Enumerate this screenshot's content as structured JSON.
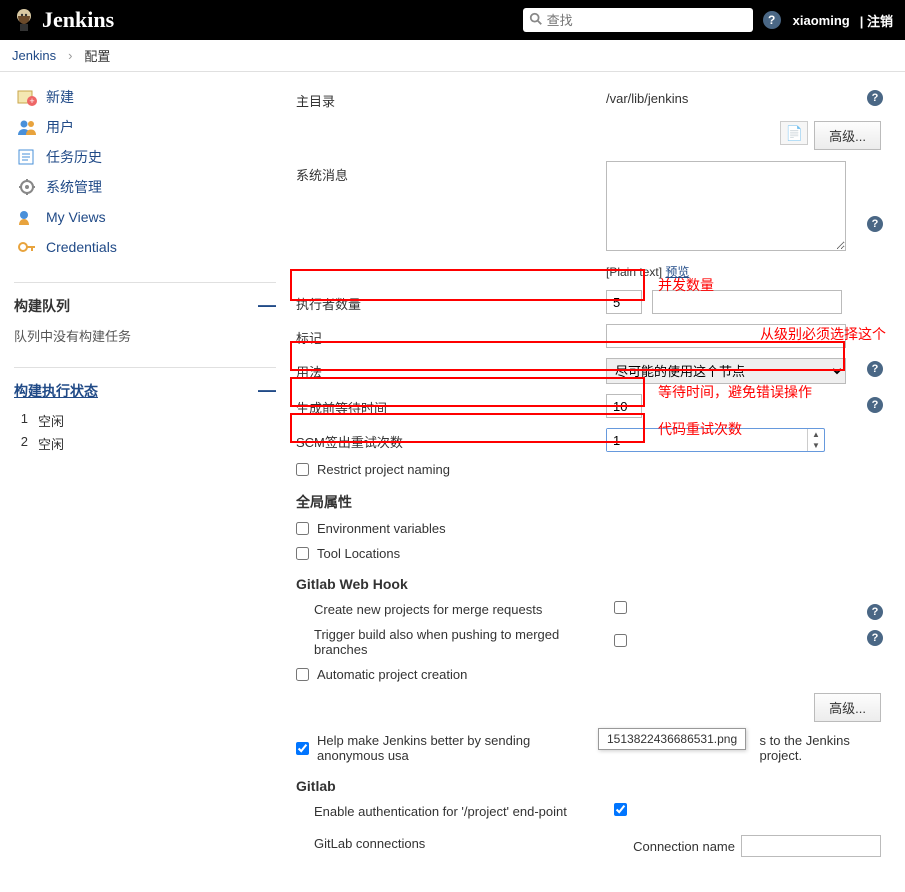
{
  "header": {
    "logo_text": "Jenkins",
    "search_placeholder": "查找",
    "user": "xiaoming",
    "logout": "| 注销"
  },
  "breadcrumb": {
    "root": "Jenkins",
    "current": "配置"
  },
  "sidebar": {
    "tasks": {
      "new": "新建",
      "people": "用户",
      "history": "任务历史",
      "manage": "系统管理",
      "myviews": "My Views",
      "credentials": "Credentials"
    },
    "queue": {
      "title": "构建队列",
      "empty": "队列中没有构建任务"
    },
    "executors": {
      "title": "构建执行状态",
      "rows": [
        {
          "n": "1",
          "label": "空闲"
        },
        {
          "n": "2",
          "label": "空闲"
        }
      ]
    }
  },
  "form": {
    "home_label": "主目录",
    "home_value": "/var/lib/jenkins",
    "sysmsg_label": "系统消息",
    "plain_text": "[Plain text]",
    "preview": "预览",
    "executors_label": "执行者数量",
    "executors_value": "5",
    "labels_label": "标记",
    "labels_value": "",
    "usage_label": "用法",
    "usage_value": "尽可能的使用这个节点",
    "quiet_label": "生成前等待时间",
    "quiet_value": "10",
    "scm_label": "SCM签出重试次数",
    "scm_value": "1",
    "restrict_label": "Restrict project naming",
    "global_props": "全局属性",
    "envvars_label": "Environment variables",
    "toolloc_label": "Tool Locations",
    "gitlab_hook": "Gitlab Web Hook",
    "git_create": "Create new projects for merge requests",
    "git_trigger": "Trigger build also when pushing to merged branches",
    "git_auto": "Automatic project creation",
    "help_usage_prefix": "Help make Jenkins better by sending anonymous usa",
    "help_usage_suffix": "s to the Jenkins project.",
    "gitlab_section": "Gitlab",
    "gitlab_auth": "Enable authentication for '/project' end-point",
    "gitlab_conn": "GitLab connections",
    "conn_name_label": "Connection name",
    "adv_button": "高级...",
    "tooltip_file": "1513822436686531.png"
  },
  "annotations": {
    "executors_note": "并发数量",
    "usage_note": "从级别必须选择这个",
    "quiet_note": "等待时间，避免错误操作",
    "scm_note": "代码重试次数"
  }
}
